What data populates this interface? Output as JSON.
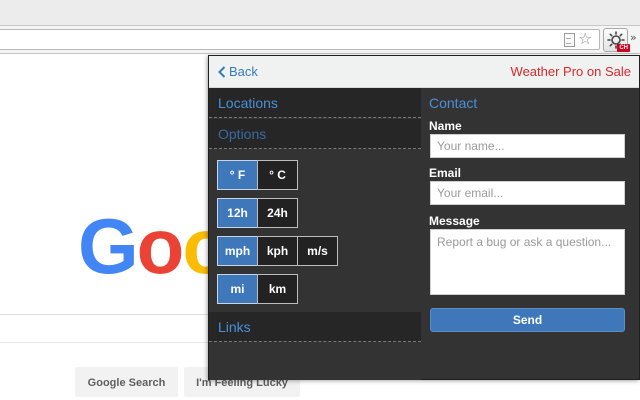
{
  "browser": {
    "extension_badge": "CH"
  },
  "google": {
    "logo_letters": [
      {
        "char": "G",
        "color": "#4285F4"
      },
      {
        "char": "o",
        "color": "#EA4335"
      },
      {
        "char": "o",
        "color": "#FBBC05"
      }
    ],
    "search_button": "Google Search",
    "lucky_button": "I'm Feeling Lucky"
  },
  "popup": {
    "back_label": "Back",
    "promo_label": "Weather Pro on Sale",
    "sections": {
      "locations": "Locations",
      "options": "Options",
      "links": "Links"
    },
    "toggles": {
      "temperature": [
        {
          "label": "° F",
          "active": true
        },
        {
          "label": "° C",
          "active": false
        }
      ],
      "time": [
        {
          "label": "12h",
          "active": true
        },
        {
          "label": "24h",
          "active": false
        }
      ],
      "speed": [
        {
          "label": "mph",
          "active": true
        },
        {
          "label": "kph",
          "active": false
        },
        {
          "label": "m/s",
          "active": false
        }
      ],
      "distance": [
        {
          "label": "mi",
          "active": true
        },
        {
          "label": "km",
          "active": false
        }
      ]
    },
    "contact": {
      "title": "Contact",
      "name_label": "Name",
      "name_placeholder": "Your name...",
      "name_value": "",
      "email_label": "Email",
      "email_placeholder": "Your email...",
      "email_value": "",
      "message_label": "Message",
      "message_placeholder": "Report a bug or ask a question...",
      "message_value": "",
      "send_label": "Send"
    },
    "colors": {
      "accent_blue": "#3f78ba",
      "promo_red": "#d8292b",
      "panel_bg": "#333333"
    }
  }
}
